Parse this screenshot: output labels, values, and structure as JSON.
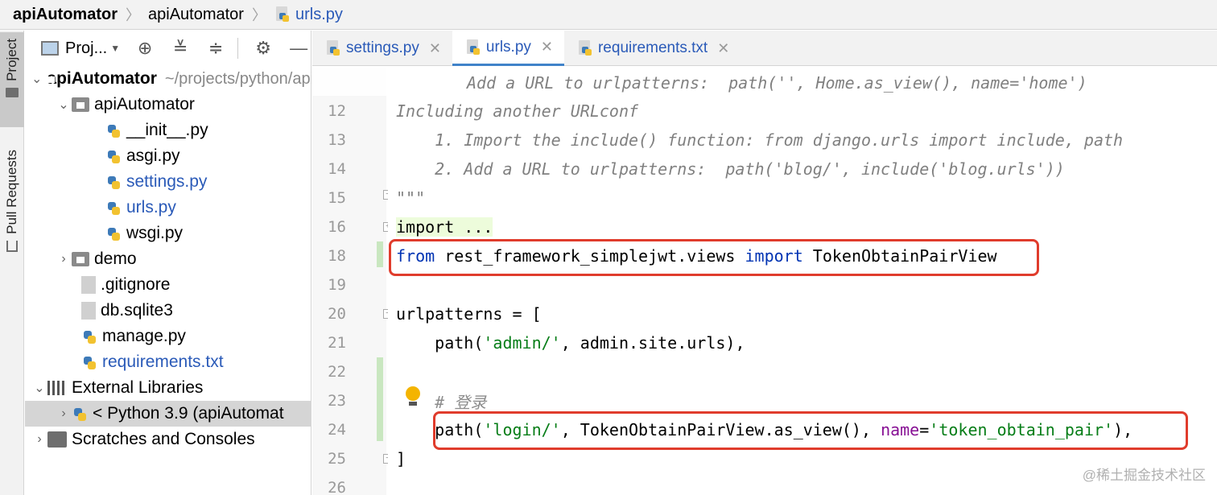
{
  "breadcrumb": {
    "project": "apiAutomator",
    "folder": "apiAutomator",
    "file": "urls.py"
  },
  "toolstrip": {
    "project_tab": "Project",
    "pull_requests_tab": "Pull Requests"
  },
  "project_panel": {
    "selector_label": "Proj...",
    "tree": [
      {
        "label": "apiAutomator",
        "hint": "~/projects/python/apiAutomator",
        "icon": "folder-icon"
      },
      {
        "label": "apiAutomator",
        "icon": "folder-icon"
      },
      {
        "label": "__init__.py",
        "icon": "python-file-icon"
      },
      {
        "label": "asgi.py",
        "icon": "python-file-icon"
      },
      {
        "label": "settings.py",
        "icon": "python-file-icon"
      },
      {
        "label": "urls.py",
        "icon": "python-file-icon"
      },
      {
        "label": "wsgi.py",
        "icon": "python-file-icon"
      },
      {
        "label": "demo",
        "icon": "folder-icon"
      },
      {
        "label": ".gitignore",
        "icon": "ignore-file-icon"
      },
      {
        "label": "db.sqlite3",
        "icon": "database-file-icon"
      },
      {
        "label": "manage.py",
        "icon": "python-file-icon"
      },
      {
        "label": "requirements.txt",
        "icon": "requirements-file-icon"
      },
      {
        "label": "External Libraries",
        "icon": "library-icon"
      },
      {
        "label": "< Python 3.9 (apiAutomat",
        "icon": "python-sdk-icon"
      },
      {
        "label": "Scratches and Consoles",
        "icon": "scratches-icon"
      }
    ]
  },
  "tabs": [
    {
      "label": "settings.py"
    },
    {
      "label": "urls.py"
    },
    {
      "label": "requirements.txt"
    }
  ],
  "editor": {
    "line_numbers": [
      "12",
      "13",
      "14",
      "15",
      "16",
      "18",
      "19",
      "20",
      "21",
      "22",
      "23",
      "24",
      "25",
      "26"
    ],
    "line11_tail": "Add a URL to urlpatterns:  path('', Home.as_view(), name='home')",
    "line12": "Including another URLconf",
    "line13": "    1. Import the include() function: from django.urls import include, path",
    "line14": "    2. Add a URL to urlpatterns:  path('blog/', include('blog.urls'))",
    "line15": "\"\"\"",
    "line16": "import ...",
    "line18": {
      "kw1": "from",
      "mod": " rest_framework_simplejwt.views ",
      "kw2": "import",
      "name": " TokenObtainPairView"
    },
    "line20": "urlpatterns = [",
    "line21": {
      "pre": "    path(",
      "str": "'admin/'",
      "post": ", admin.site.urls),"
    },
    "line23": "    # 登录",
    "line24": {
      "pre": "    path(",
      "str1": "'login/'",
      "mid": ", TokenObtainPairView.as_view(), ",
      "param": "name",
      "eq": "=",
      "str2": "'token_obtain_pair'",
      "post": "),"
    },
    "line25": "]"
  },
  "watermark": "@稀土掘金技术社区",
  "colors": {
    "keyword": "#0033b3",
    "string": "#067d17",
    "param": "#871094",
    "highlight_box": "#e03c2c",
    "link_blue": "#2a5ab8"
  }
}
